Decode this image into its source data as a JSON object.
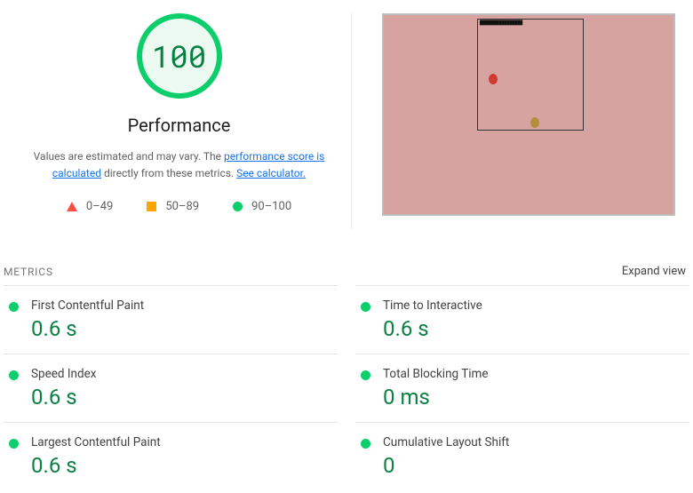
{
  "gauge": {
    "score": "100",
    "title": "Performance"
  },
  "estimate": {
    "prefix": "Values are estimated and may vary. The ",
    "link1": "performance score is calculated",
    "mid": " directly from these metrics. ",
    "link2": "See calculator."
  },
  "legend": {
    "fail": "0–49",
    "average": "50–89",
    "pass": "90–100"
  },
  "metricsHeader": {
    "title": "METRICS",
    "expand": "Expand view"
  },
  "metrics": [
    {
      "name": "First Contentful Paint",
      "value": "0.6 s"
    },
    {
      "name": "Time to Interactive",
      "value": "0.6 s"
    },
    {
      "name": "Speed Index",
      "value": "0.6 s"
    },
    {
      "name": "Total Blocking Time",
      "value": "0 ms"
    },
    {
      "name": "Largest Contentful Paint",
      "value": "0.6 s"
    },
    {
      "name": "Cumulative Layout Shift",
      "value": "0"
    }
  ]
}
